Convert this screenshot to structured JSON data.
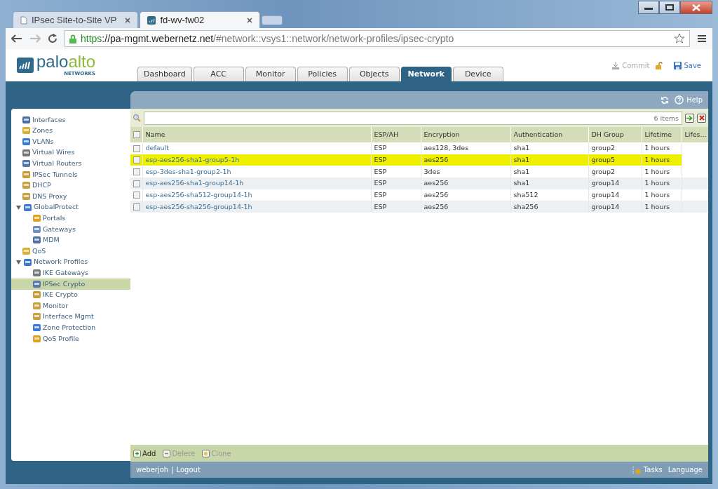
{
  "browser": {
    "tabs": [
      {
        "title": "IPsec Site-to-Site VP",
        "selected": false
      },
      {
        "title": "fd-wv-fw02",
        "selected": true
      }
    ],
    "url": {
      "scheme": "https",
      "host": "://pa-mgmt.webernetz.net",
      "path": "/#network::vsys1::network/network-profiles/ipsec-crypto"
    }
  },
  "app": {
    "logo": {
      "brand_a": "palo",
      "brand_b": "alto",
      "sub": "NETWORKS"
    },
    "tabs": [
      {
        "label": "Dashboard",
        "selected": false
      },
      {
        "label": "ACC",
        "selected": false
      },
      {
        "label": "Monitor",
        "selected": false
      },
      {
        "label": "Policies",
        "selected": false
      },
      {
        "label": "Objects",
        "selected": false
      },
      {
        "label": "Network",
        "selected": true
      },
      {
        "label": "Device",
        "selected": false
      }
    ],
    "actions": [
      {
        "label": "Commit",
        "disabled": true
      },
      {
        "label": "Save",
        "disabled": false
      }
    ]
  },
  "sidebar": {
    "items": [
      {
        "label": "Interfaces",
        "selected": false
      },
      {
        "label": "Zones",
        "selected": false
      },
      {
        "label": "VLANs",
        "selected": false
      },
      {
        "label": "Virtual Wires",
        "selected": false
      },
      {
        "label": "Virtual Routers",
        "selected": false
      },
      {
        "label": "IPSec Tunnels",
        "selected": false
      },
      {
        "label": "DHCP",
        "selected": false
      },
      {
        "label": "DNS Proxy",
        "selected": false
      },
      {
        "label": "GlobalProtect",
        "selected": false,
        "expanded": true,
        "children": [
          {
            "label": "Portals",
            "selected": false
          },
          {
            "label": "Gateways",
            "selected": false
          },
          {
            "label": "MDM",
            "selected": false
          }
        ]
      },
      {
        "label": "QoS",
        "selected": false
      },
      {
        "label": "Network Profiles",
        "selected": false,
        "expanded": true,
        "children": [
          {
            "label": "IKE Gateways",
            "selected": false
          },
          {
            "label": "IPSec Crypto",
            "selected": true
          },
          {
            "label": "IKE Crypto",
            "selected": false
          },
          {
            "label": "Monitor",
            "selected": false
          },
          {
            "label": "Interface Mgmt",
            "selected": false
          },
          {
            "label": "Zone Protection",
            "selected": false
          },
          {
            "label": "QoS Profile",
            "selected": false
          }
        ]
      }
    ]
  },
  "toolbar": {
    "help": "Help",
    "count": "6 items"
  },
  "table": {
    "all_checked": false,
    "columns": [
      "Name",
      "ESP/AH",
      "Encryption",
      "Authentication",
      "DH Group",
      "Lifetime",
      "Lifes..."
    ],
    "rows": [
      {
        "cells": [
          "default",
          "ESP",
          "aes128, 3des",
          "sha1",
          "group2",
          "1 hours"
        ],
        "checked": false,
        "highlighted": false
      },
      {
        "cells": [
          "esp-aes256-sha1-group5-1h",
          "ESP",
          "aes256",
          "sha1",
          "group5",
          "1 hours"
        ],
        "checked": false,
        "highlighted": true
      },
      {
        "cells": [
          "esp-3des-sha1-group2-1h",
          "ESP",
          "3des",
          "sha1",
          "group2",
          "1 hours"
        ],
        "checked": false,
        "highlighted": false
      },
      {
        "cells": [
          "esp-aes256-sha1-group14-1h",
          "ESP",
          "aes256",
          "sha1",
          "group14",
          "1 hours"
        ],
        "checked": false,
        "highlighted": false
      },
      {
        "cells": [
          "esp-aes256-sha512-group14-1h",
          "ESP",
          "aes256",
          "sha512",
          "group14",
          "1 hours"
        ],
        "checked": false,
        "highlighted": false
      },
      {
        "cells": [
          "esp-aes256-sha256-group14-1h",
          "ESP",
          "aes256",
          "sha256",
          "group14",
          "1 hours"
        ],
        "checked": false,
        "highlighted": false
      }
    ]
  },
  "footer_buttons": [
    {
      "label": "Add",
      "disabled": false
    },
    {
      "label": "Delete",
      "disabled": true
    },
    {
      "label": "Clone",
      "disabled": true
    }
  ],
  "status_bar": {
    "user": "weberjoh",
    "separator": "|",
    "logout": "Logout",
    "tasks": "Tasks",
    "language": "Language"
  }
}
